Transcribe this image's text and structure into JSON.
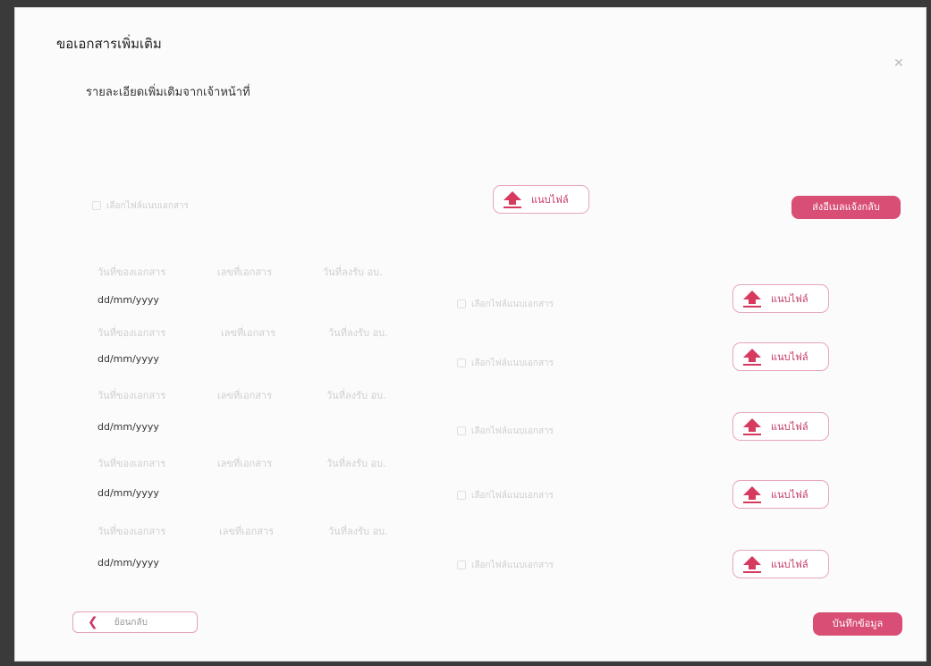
{
  "dialog": {
    "title": "ขอเอกสารเพิ่มเติม",
    "subtitle": "รายละเอียดเพิ่มเติมจากเจ้าหน้าที่",
    "close_icon": "close-icon"
  },
  "top_row": {
    "file_placeholder": "เลือกไฟล์แนบเอกสาร",
    "upload_label": "แนบไฟล์",
    "send_email_label": "ส่งอีเมลแจ้งกลับ"
  },
  "columns": {
    "doc_date": "วันที่ของเอกสาร",
    "doc_number": "เลขที่เอกสาร",
    "received_date": "วันที่ลงรับ อบ."
  },
  "rows": [
    {
      "date": "dd/mm/yyyy",
      "file_placeholder": "เลือกไฟล์แนบเอกสาร",
      "upload_label": "แนบไฟล์"
    },
    {
      "date": "dd/mm/yyyy",
      "file_placeholder": "เลือกไฟล์แนบเอกสาร",
      "upload_label": "แนบไฟล์"
    },
    {
      "date": "dd/mm/yyyy",
      "file_placeholder": "เลือกไฟล์แนบเอกสาร",
      "upload_label": "แนบไฟล์"
    },
    {
      "date": "dd/mm/yyyy",
      "file_placeholder": "เลือกไฟล์แนบเอกสาร",
      "upload_label": "แนบไฟล์"
    },
    {
      "date": "dd/mm/yyyy",
      "file_placeholder": "เลือกไฟล์แนบเอกสาร",
      "upload_label": "แนบไฟล์"
    }
  ],
  "footer": {
    "back_label": "ย้อนกลับ",
    "save_label": "บันทึกข้อมูล"
  },
  "colors": {
    "accent": "#d84e75",
    "upload_arrow": "#d63a5e"
  }
}
